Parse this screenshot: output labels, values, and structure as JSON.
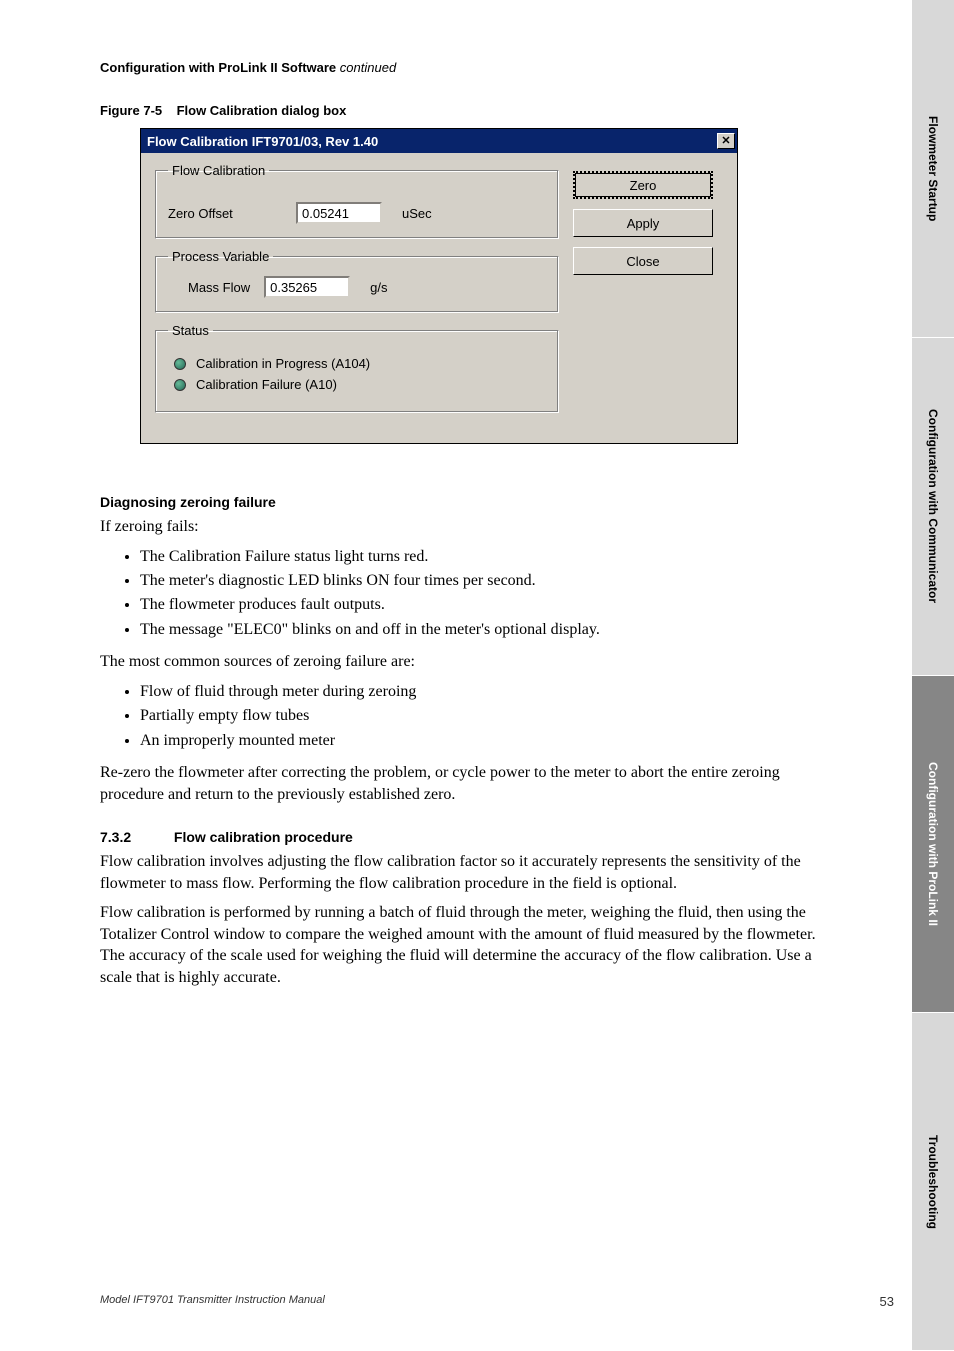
{
  "header": {
    "text": "Configuration with ProLink II Software",
    "suffix": "continued"
  },
  "figure": {
    "label": "Figure 7-5",
    "title": "Flow Calibration dialog box"
  },
  "dialog": {
    "title": "Flow Calibration IFT9701/03, Rev 1.40",
    "flow_cal_legend": "Flow Calibration",
    "zero_offset_label": "Zero Offset",
    "zero_offset_value": "0.05241",
    "zero_offset_unit": "uSec",
    "process_var_legend": "Process Variable",
    "mass_flow_label": "Mass Flow",
    "mass_flow_value": "0.35265",
    "mass_flow_unit": "g/s",
    "status_legend": "Status",
    "status_a104": "Calibration in Progress (A104)",
    "status_a10": "Calibration Failure (A10)",
    "btn_zero": "Zero",
    "btn_apply": "Apply",
    "btn_close": "Close"
  },
  "section1": {
    "heading": "Diagnosing zeroing failure",
    "intro": "If zeroing fails:",
    "bullets_a": [
      "The Calibration Failure status light turns red.",
      "The meter's diagnostic LED blinks ON four times per second.",
      "The flowmeter produces fault outputs.",
      "The message \"ELEC0\" blinks on and off in the meter's optional display."
    ],
    "common_intro": "The most common sources of zeroing failure are:",
    "bullets_b": [
      "Flow of fluid through meter during zeroing",
      "Partially empty flow tubes",
      "An improperly mounted meter"
    ],
    "rezero": "Re-zero the flowmeter after correcting the problem, or cycle power to the meter to abort the entire zeroing procedure and return to the previously established zero."
  },
  "section2": {
    "number": "7.3.2",
    "heading": "Flow calibration procedure",
    "p1": "Flow calibration involves adjusting the flow calibration factor so it accurately represents the sensitivity of the flowmeter to mass flow. Performing the flow calibration procedure in the field is optional.",
    "p2": "Flow calibration is performed by running a batch of fluid through the meter, weighing the fluid, then using the Totalizer Control window to compare the weighed amount with the amount of fluid measured by the flowmeter. The accuracy of the scale used for weighing the fluid will determine the accuracy of the flow calibration. Use a scale that is highly accurate."
  },
  "footer": {
    "left": "Model IFT9701 Transmitter Instruction Manual",
    "page": "53"
  },
  "tabs": [
    "Flowmeter Startup",
    "Configuration with Communicator",
    "Configuration with ProLink II",
    "Troubleshooting"
  ]
}
